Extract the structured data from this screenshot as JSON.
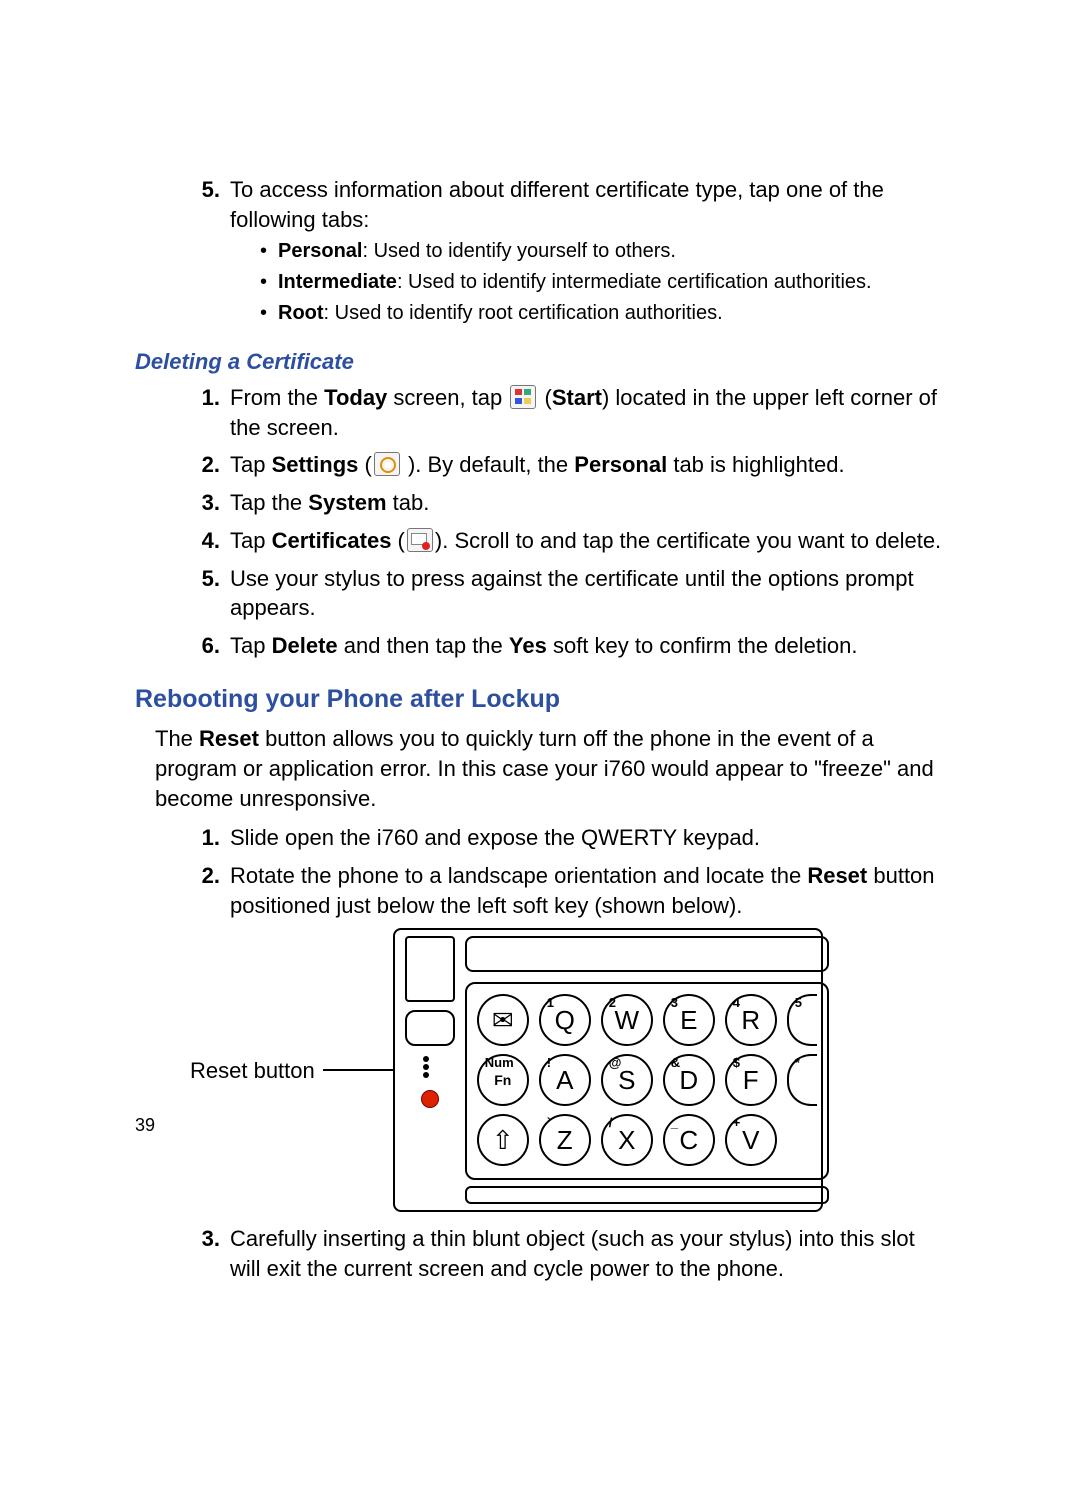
{
  "certTabs": {
    "num": "5.",
    "lead": "To access information about different certificate type, tap one of the following tabs:",
    "items": [
      {
        "bold": "Personal",
        "rest": ": Used to identify yourself to others."
      },
      {
        "bold": "Intermediate",
        "rest": ": Used to identify intermediate certification authorities."
      },
      {
        "bold": "Root",
        "rest": ": Used to identify root certification authorities."
      }
    ]
  },
  "delHeading": "Deleting a Certificate",
  "delSteps": [
    {
      "n": "1.",
      "pre": "From the ",
      "b1": "Today",
      "mid1": " screen, tap ",
      "b2": "Start",
      "mid2": " (",
      "icon": "start",
      "post": ") located in the upper left corner of the screen."
    },
    {
      "n": "2.",
      "pre": "Tap ",
      "b1": "Settings",
      "mid1": " (",
      "icon": "settings",
      "mid2": " ). By default, the ",
      "b2": "Personal",
      "post": " tab is highlighted."
    },
    {
      "n": "3.",
      "pre": "Tap the ",
      "b1": "System",
      "post": " tab."
    },
    {
      "n": "4.",
      "pre": "Tap ",
      "b1": "Certificates",
      "mid1": " (",
      "icon": "cert",
      "post": "). Scroll to and tap the certificate you want to delete."
    },
    {
      "n": "5.",
      "pre": "Use your stylus to press against the certificate until the options prompt appears."
    },
    {
      "n": "6.",
      "pre": "Tap ",
      "b1": "Delete",
      "mid1": " and then tap the ",
      "b2": "Yes",
      "post": " soft key to confirm the deletion."
    }
  ],
  "rebootHeading": "Rebooting your Phone after Lockup",
  "rebootParaParts": {
    "p1": "The ",
    "b": "Reset",
    "p2": " button allows you to quickly turn off the phone in the event of a program or application error. In this case your i760 would appear to \"freeze\" and become unresponsive."
  },
  "rebootSteps": {
    "s1": {
      "n": "1.",
      "t": "Slide open the i760 and expose the QWERTY keypad."
    },
    "s2": {
      "n": "2.",
      "p1": "Rotate the phone to a landscape orientation and locate the ",
      "b": "Reset",
      "p2": " button positioned just below the left soft key (shown below)."
    },
    "s3": {
      "n": "3.",
      "t": "Carefully inserting a thin blunt object (such as your stylus) into this slot will exit the current screen and cycle power to the phone."
    }
  },
  "diagram": {
    "resetLabel": "Reset button",
    "rows": [
      [
        {
          "sup": "",
          "label": "✉",
          "cls": ""
        },
        {
          "sup": "1",
          "label": "Q"
        },
        {
          "sup": "2",
          "label": "W"
        },
        {
          "sup": "3",
          "label": "E"
        },
        {
          "sup": "4",
          "label": "R"
        },
        {
          "sup": "5",
          "label": "",
          "cls": "partial"
        }
      ],
      [
        {
          "sup": "Num",
          "label": "Fn",
          "cls": "small-label"
        },
        {
          "sup": "!",
          "label": "A"
        },
        {
          "sup": "@",
          "label": "S"
        },
        {
          "sup": "&",
          "label": "D"
        },
        {
          "sup": "$",
          "label": "F"
        },
        {
          "sup": "*",
          "label": "",
          "cls": "partial"
        }
      ],
      [
        {
          "sup": "",
          "label": "⇧"
        },
        {
          "sup": "`",
          "label": "Z"
        },
        {
          "sup": "/",
          "label": "X"
        },
        {
          "sup": "_",
          "label": "C"
        },
        {
          "sup": "+",
          "label": "V"
        }
      ]
    ]
  },
  "pageNumber": "39"
}
